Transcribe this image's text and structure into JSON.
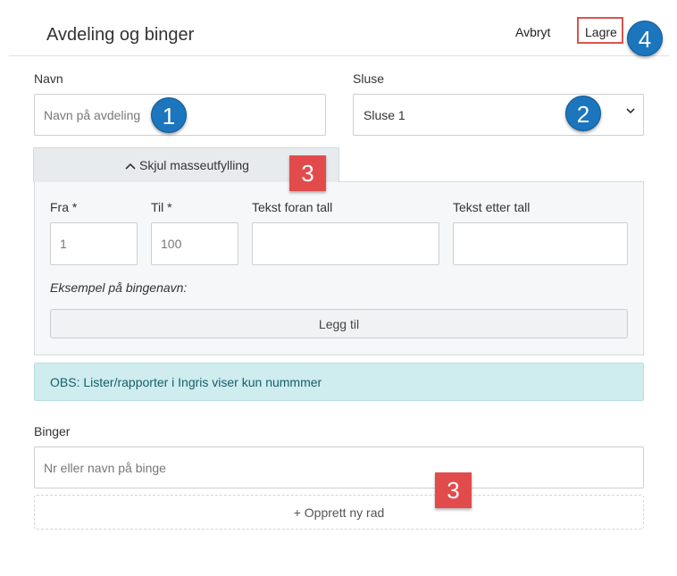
{
  "header": {
    "title": "Avdeling og binger",
    "cancel_label": "Avbryt",
    "save_label": "Lagre"
  },
  "form": {
    "name_label": "Navn",
    "name_placeholder": "Navn på avdeling",
    "lock_label": "Sluse",
    "lock_value": "Sluse 1"
  },
  "mass_fill": {
    "toggle_label": "Skjul masseutfylling",
    "from_label": "Fra *",
    "from_value": "1",
    "to_label": "Til *",
    "to_value": "100",
    "prefix_label": "Tekst foran tall",
    "suffix_label": "Tekst etter tall",
    "example_label": "Eksempel på bingenavn:",
    "add_label": "Legg til"
  },
  "notice": "OBS: Lister/rapporter i Ingris viser kun nummmer",
  "bins": {
    "label": "Binger",
    "placeholder": "Nr eller navn på binge",
    "new_row_label": "+ Opprett ny rad"
  },
  "callouts": {
    "badge_1": "1",
    "badge_2": "2",
    "badge_3a": "3",
    "badge_3b": "3",
    "badge_4": "4"
  },
  "colors": {
    "callout_circle": "#1b76bd",
    "callout_square": "#e24b4b",
    "save_highlight": "#d9534f",
    "notice_bg": "#cfecef"
  },
  "icons": {
    "toggle": "chevron-up-icon",
    "select": "chevron-down-icon"
  }
}
